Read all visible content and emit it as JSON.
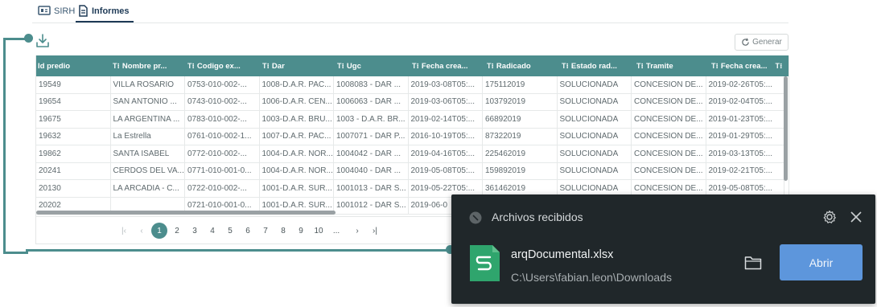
{
  "tabs": [
    {
      "label": "SIRH"
    },
    {
      "label": "Informes"
    }
  ],
  "toolbar": {
    "generar_label": "Generar"
  },
  "grid": {
    "columns": [
      "Id predio",
      "Nombre pr...",
      "Codigo ex...",
      "Dar",
      "Ugc",
      "Fecha crea...",
      "Radicado",
      "Estado rad...",
      "Tramite",
      "Fecha crea..."
    ],
    "rows": [
      [
        "19549",
        "VILLA ROSARIO",
        "0753-010-002-...",
        "1008-D.A.R. PAC...",
        "1008083 - DAR ...",
        "2019-03-08T05:...",
        "175112019",
        "SOLUCIONADA",
        "CONCESION DE...",
        "2019-02-26T05:..."
      ],
      [
        "19654",
        "SAN ANTONIO ...",
        "0743-010-002-...",
        "1006-D.A.R. CEN...",
        "1006063 - DAR ...",
        "2019-03-06T05:...",
        "103792019",
        "SOLUCIONADA",
        "CONCESION DE...",
        "2019-02-04T05:..."
      ],
      [
        "19675",
        "LA ARGENTINA ...",
        "0783-010-002-...",
        "1003-D.A.R. BRU...",
        "1003 - D.A.R. BR...",
        "2019-02-14T05:...",
        "66892019",
        "SOLUCIONADA",
        "CONCESION DE...",
        "2019-01-23T05:..."
      ],
      [
        "19632",
        "La Estrella",
        "0761-010-002-1...",
        "1007-D.A.R. PAC...",
        "1007071 - DAR P...",
        "2016-10-19T05:...",
        "87322019",
        "SOLUCIONADA",
        "CONCESION DE...",
        "2019-01-29T05:..."
      ],
      [
        "19862",
        "SANTA ISABEL",
        "0772-010-002-...",
        "1004-D.A.R. NOR...",
        "1004042 - DAR ...",
        "2019-04-16T05:...",
        "225462019",
        "SOLUCIONADA",
        "CONCESION DE...",
        "2019-03-13T05:..."
      ],
      [
        "20241",
        "CERDOS DEL VA...",
        "0771-010-001-0...",
        "1004-D.A.R. NOR...",
        "1004040 - DAR ...",
        "2019-05-08T05:...",
        "159892019",
        "SOLUCIONADA",
        "CONCESION DE...",
        "2019-02-21T05:..."
      ],
      [
        "20130",
        "LA ARCADIA - C...",
        "0722-010-002-...",
        "1001-D.A.R. SUR...",
        "1001013 - DAR S...",
        "2019-05-22T05:...",
        "361462019",
        "SOLUCIONADA",
        "CONCESION DE...",
        "2019-05-08T05:..."
      ],
      [
        "20202",
        "",
        "0721-010-001-0...",
        "1001-D.A.R. SUR...",
        "1001012 - DAR S...",
        "2019-06-0",
        "",
        "",
        "",
        ""
      ]
    ]
  },
  "pager": {
    "pages": [
      "1",
      "2",
      "3",
      "4",
      "5",
      "6",
      "7",
      "8",
      "9",
      "10",
      "..."
    ],
    "current": "1"
  },
  "toast": {
    "title": "Archivos recibidos",
    "file_name": "arqDocumental.xlsx",
    "file_path": "C:\\Users\\fabian.leon\\Downloads",
    "open_label": "Abrir"
  },
  "colors": {
    "accent": "#4c8d8d",
    "toast_bg": "#20272a",
    "open_button": "#5d96dc",
    "excel_icon": "#2fa56d"
  }
}
